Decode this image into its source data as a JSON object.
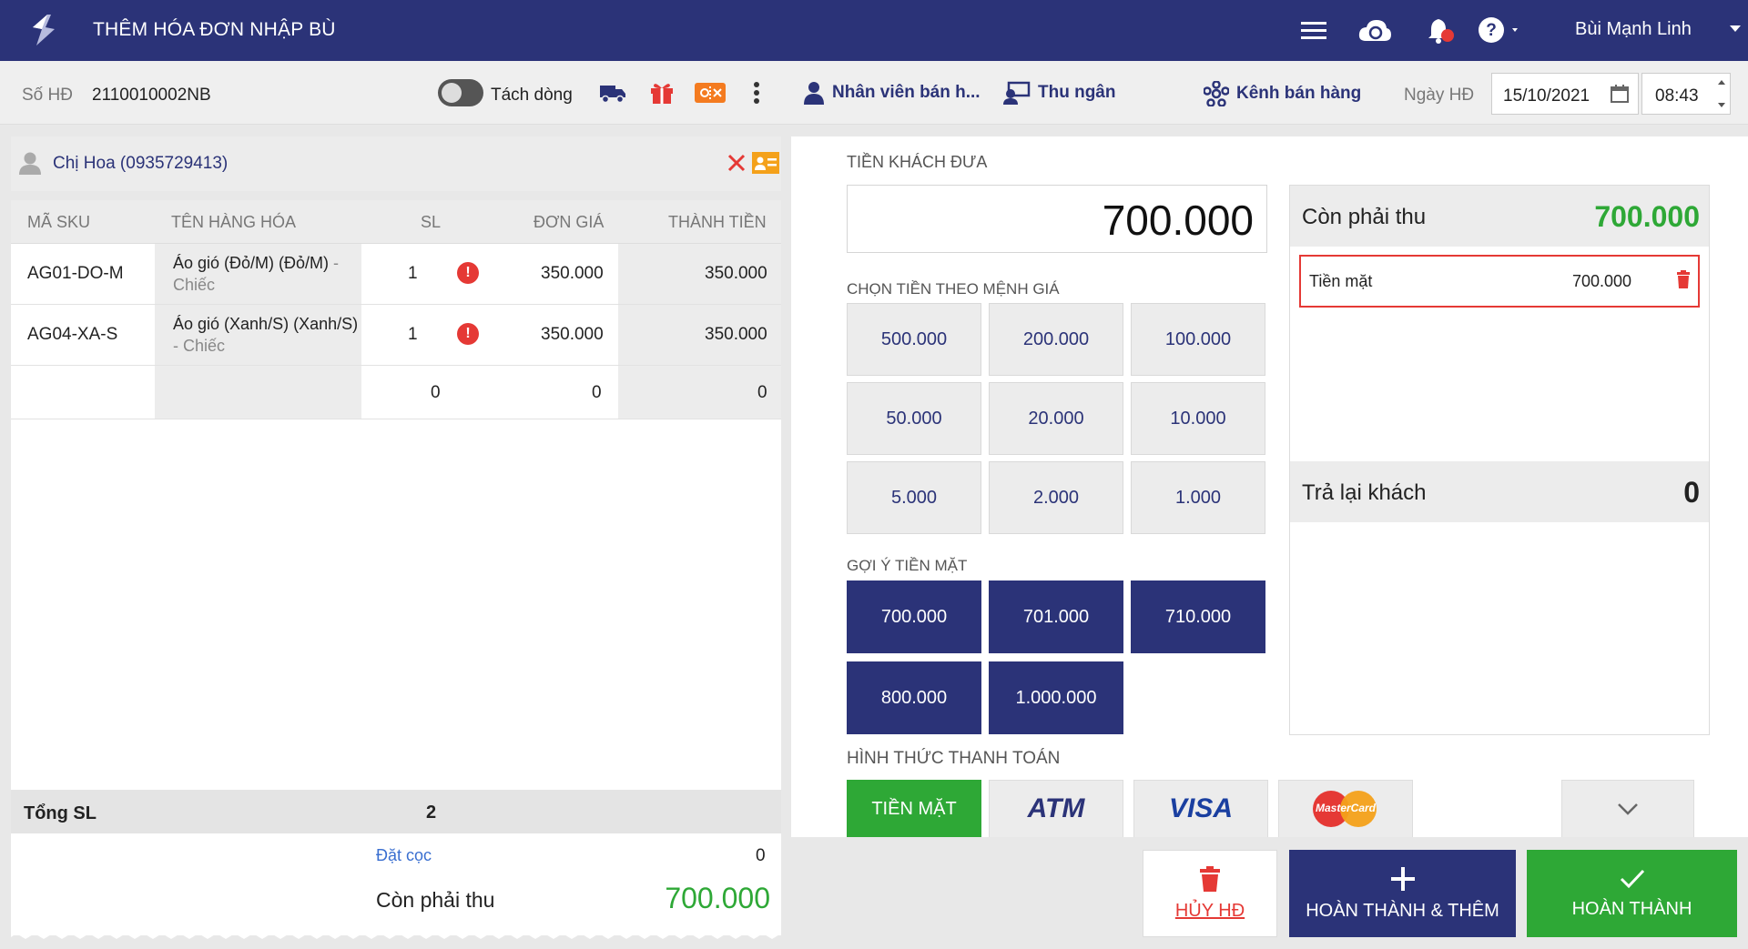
{
  "header": {
    "title": "THÊM HÓA ĐƠN NHẬP BÙ",
    "user": "Bùi Mạnh Linh"
  },
  "infobar": {
    "invoice_label": "Số HĐ",
    "invoice_no": "2110010002NB",
    "split_label": "Tách dòng",
    "staff_label": "Nhân viên bán h...",
    "cashier_label": "Thu ngân",
    "channel_label": "Kênh bán hàng",
    "date_label": "Ngày HĐ",
    "date": "15/10/2021",
    "time": "08:43"
  },
  "customer": {
    "name": "Chị Hoa (0935729413)"
  },
  "table": {
    "headers": [
      "MÃ SKU",
      "TÊN HÀNG HÓA",
      "SL",
      "ĐƠN GIÁ",
      "THÀNH TIỀN"
    ],
    "rows": [
      {
        "sku": "AG01-DO-M",
        "name": "Áo gió (Đỏ/M) (Đỏ/M)",
        "unit": "- Chiếc",
        "qty": "1",
        "price": "350.000",
        "total": "350.000"
      },
      {
        "sku": "AG04-XA-S",
        "name": "Áo gió (Xanh/S) (Xanh/S)",
        "unit": "- Chiếc",
        "qty": "1",
        "price": "350.000",
        "total": "350.000"
      }
    ],
    "empty_row": {
      "qty": "0",
      "price": "0",
      "total": "0"
    }
  },
  "totals": {
    "total_qty_label": "Tổng SL",
    "total_qty": "2",
    "deposit_label": "Đặt cọc",
    "deposit": "0",
    "remaining_label": "Còn phải thu",
    "remaining": "700.000"
  },
  "payment": {
    "given_label": "TIỀN KHÁCH ĐƯA",
    "given_amount": "700.000",
    "denom_label": "CHỌN TIỀN THEO MỆNH GIÁ",
    "denominations": [
      "500.000",
      "200.000",
      "100.000",
      "50.000",
      "20.000",
      "10.000",
      "5.000",
      "2.000",
      "1.000"
    ],
    "suggest_label": "GỢI Ý TIỀN MẶT",
    "suggestions": [
      "700.000",
      "701.000",
      "710.000",
      "800.000",
      "1.000.000"
    ],
    "method_label": "HÌNH THỨC THANH TOÁN",
    "methods": {
      "cash": "TIỀN MẶT",
      "atm": "ATM",
      "visa": "VISA",
      "master": "MasterCard"
    }
  },
  "summary": {
    "remaining_label": "Còn phải thu",
    "remaining": "700.000",
    "cash_label": "Tiền mặt",
    "cash_amount": "700.000",
    "change_label": "Trả lại khách",
    "change": "0"
  },
  "actions": {
    "cancel": "HỦY HĐ",
    "complete_add": "HOÀN THÀNH & THÊM",
    "complete": "HOÀN THÀNH"
  },
  "colors": {
    "primary": "#2b3378",
    "green": "#2ea836",
    "danger": "#e53935",
    "orange": "#f4a11a"
  }
}
